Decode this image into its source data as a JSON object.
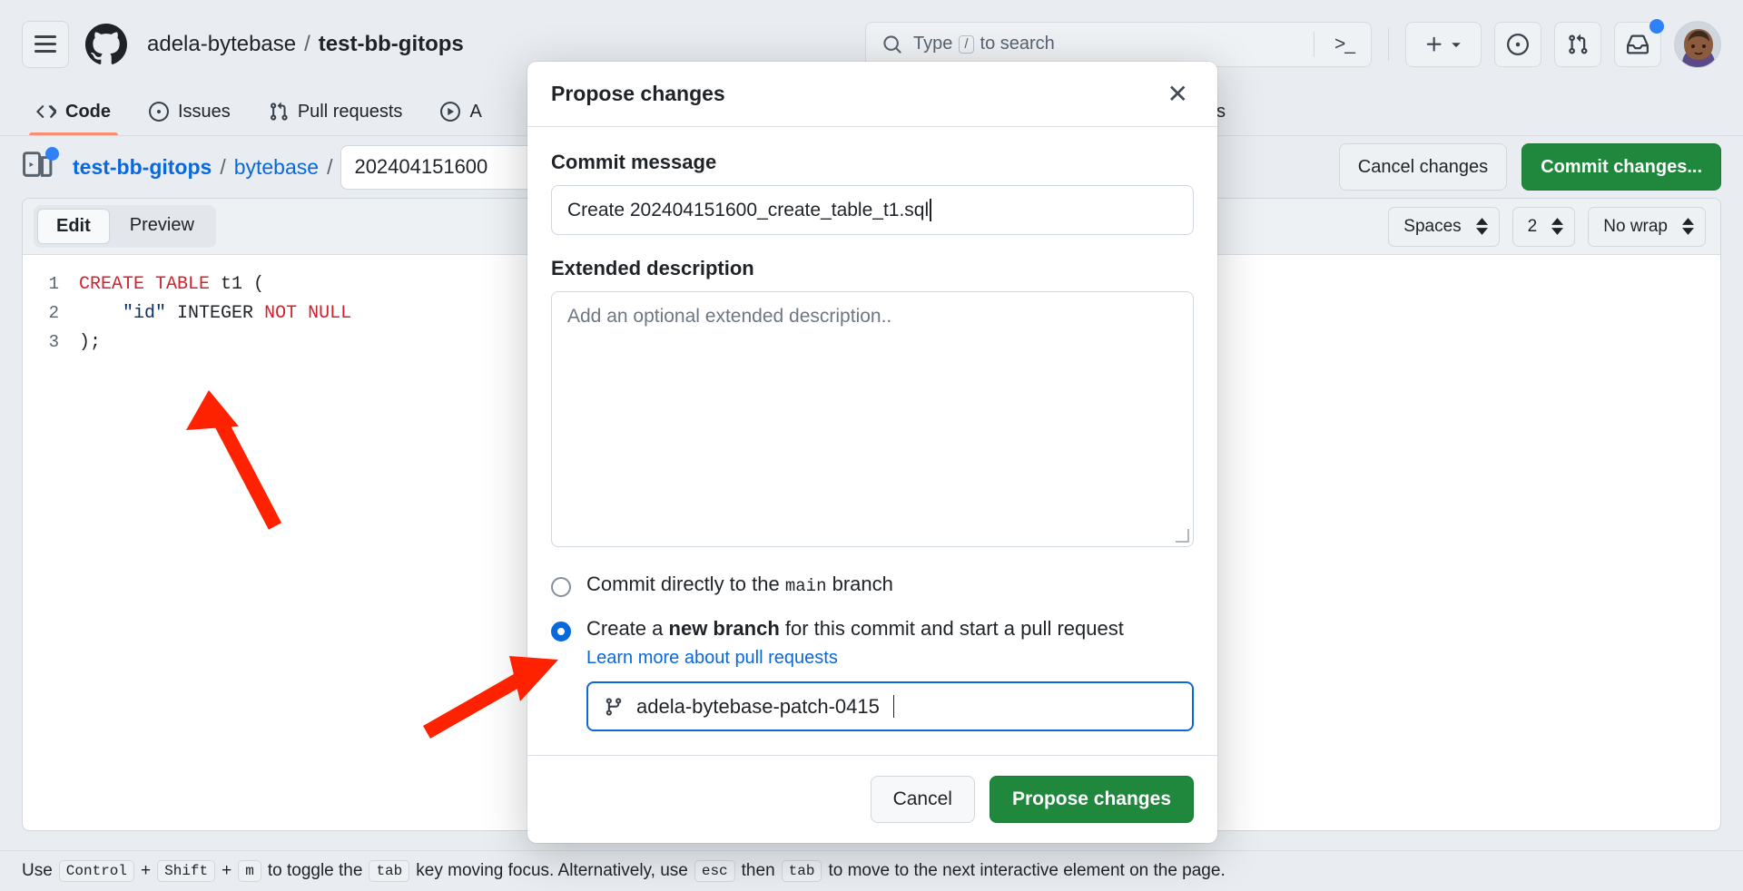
{
  "header": {
    "owner": "adela-bytebase",
    "separator": "/",
    "repo": "test-bb-gitops",
    "menu_icon": "hamburger-icon",
    "logo_icon": "github-logo-icon",
    "search": {
      "placeholder": "Type / to search",
      "key_hint": "/",
      "terminal_icon": "terminal-icon"
    },
    "actions": {
      "create_new": "+",
      "create_new_caret": "chevron-down-icon",
      "issues_icon": "issues-circle-icon",
      "pull_requests_icon": "pull-request-icon",
      "inbox_icon": "inbox-icon",
      "avatar": "user-avatar"
    }
  },
  "nav": {
    "tabs": [
      {
        "label": "Code",
        "icon": "code-icon",
        "active": true
      },
      {
        "label": "Issues",
        "icon": "issues-icon",
        "active": false
      },
      {
        "label": "Pull requests",
        "icon": "pull-request-icon",
        "active": false
      },
      {
        "label": "A",
        "icon": "actions-play-icon",
        "active": false
      },
      {
        "label": "Settings",
        "icon": "gear-icon",
        "active": false
      }
    ]
  },
  "file_bar": {
    "repo_link": "test-bb-gitops",
    "folder_link": "bytebase",
    "slash": "/",
    "filename_value": "202404151600",
    "cancel_label": "Cancel changes",
    "commit_label": "Commit changes..."
  },
  "editor": {
    "tabs": [
      {
        "label": "Edit",
        "active": true
      },
      {
        "label": "Preview",
        "active": false
      }
    ],
    "indent_mode": "Spaces",
    "indent_size": "2",
    "wrap_mode": "No wrap",
    "lines": [
      {
        "number": "1",
        "tokens": [
          {
            "t": "CREATE TABLE",
            "c": "kw"
          },
          {
            "t": " t1 (",
            "c": ""
          }
        ]
      },
      {
        "number": "2",
        "tokens": [
          {
            "t": "    ",
            "c": ""
          },
          {
            "t": "\"id\"",
            "c": "str"
          },
          {
            "t": " INTEGER ",
            "c": ""
          },
          {
            "t": "NOT NULL",
            "c": "kw"
          }
        ]
      },
      {
        "number": "3",
        "tokens": [
          {
            "t": ");",
            "c": ""
          }
        ]
      }
    ]
  },
  "status_bar": {
    "p1": "Use",
    "k1": "Control",
    "plus": "+",
    "k2": "Shift",
    "plus2": "+",
    "k3": "m",
    "p2": "to toggle the",
    "k4": "tab",
    "p3": "key moving focus. Alternatively, use",
    "k5": "esc",
    "p4": "then",
    "k6": "tab",
    "p5": "to move to the next interactive element on the page."
  },
  "modal": {
    "title": "Propose changes",
    "close_icon": "close-icon",
    "commit_message_label": "Commit message",
    "commit_message_value": "Create 202404151600_create_table_t1.sql",
    "extended_description_label": "Extended description",
    "extended_description_placeholder": "Add an optional extended description..",
    "radio_direct": {
      "pre": "Commit directly to the",
      "branch": "main",
      "post": "branch",
      "selected": false
    },
    "radio_new_branch": {
      "pre": "Create a",
      "strong": "new branch",
      "post": "for this commit and start a pull request",
      "selected": true
    },
    "learn_more_link": "Learn more about pull requests",
    "branch_icon": "branch-icon",
    "branch_value": "adela-bytebase-patch-0415",
    "cancel_label": "Cancel",
    "submit_label": "Propose changes"
  },
  "colors": {
    "accent_blue": "#0969da",
    "green": "#1f883d",
    "orange_underline": "#fd8c73",
    "arrow_red": "#ff2200",
    "page_bg": "#e9edf1"
  }
}
